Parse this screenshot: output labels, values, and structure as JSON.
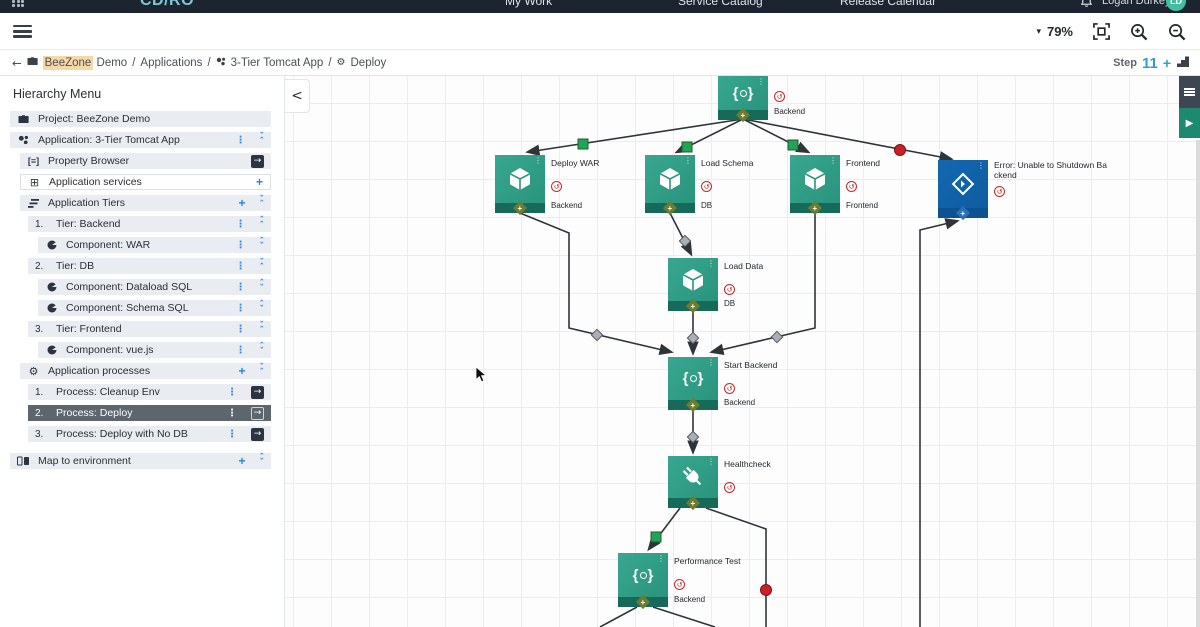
{
  "palette": {
    "teal": "#2a947d",
    "blue": "#0f5ca0",
    "red": "#c62828",
    "green_marker": "#21a453",
    "accent_blue": "#2e7fe0"
  },
  "icons": {
    "caret": "▾",
    "back": "←",
    "menu": "⋮",
    "plus": "+",
    "arrow": "→",
    "play": "▶",
    "collapse_left": "<",
    "services": "⊞",
    "gear": "⚙",
    "brackets": "[≡]",
    "chev_up": "ˆ",
    "chev_down": "ˇ",
    "badge": "↺",
    "dots": "⋮"
  },
  "topnav": {
    "logo": "CD/RO",
    "items": [
      {
        "label": "My Work"
      },
      {
        "label": "Service Catalog"
      },
      {
        "label": "Release Calendar"
      }
    ],
    "user": "Logan Durkey",
    "avatar_initials": "LD"
  },
  "toolbar": {
    "zoom_value": "79%"
  },
  "breadcrumb": {
    "project": "BeeZone",
    "project_suffix": "Demo",
    "separator": "/",
    "segments": [
      "Applications",
      "3-Tier Tomcat App",
      "Deploy"
    ],
    "step_label": "Step",
    "step_value": "11",
    "step_plus": "+"
  },
  "sidebar": {
    "title": "Hierarchy Menu",
    "items": [
      {
        "icon": "briefcase",
        "label": "Project: BeeZone Demo",
        "indent": 0,
        "actions": []
      },
      {
        "icon": "app",
        "label": "Application: 3-Tier Tomcat App",
        "indent": 0,
        "actions": [
          "menu",
          "collapse"
        ]
      },
      {
        "icon": "brackets",
        "label": "Property Browser",
        "indent": 1,
        "actions": [
          "arrow"
        ]
      },
      {
        "icon": "services",
        "label": "Application services",
        "indent": 1,
        "light": true,
        "actions": [
          "plus"
        ]
      },
      {
        "icon": "tiers",
        "label": "Application Tiers",
        "indent": 1,
        "actions": [
          "plus",
          "collapse"
        ]
      },
      {
        "num": "1.",
        "label": "Tier: Backend",
        "indent": 2,
        "actions": [
          "menu",
          "collapse"
        ]
      },
      {
        "icon": "component",
        "label": "Component: WAR",
        "indent": 3,
        "actions": [
          "menu",
          "expand"
        ]
      },
      {
        "num": "2.",
        "label": "Tier: DB",
        "indent": 2,
        "actions": [
          "menu",
          "collapse"
        ]
      },
      {
        "icon": "component",
        "label": "Component: Dataload SQL",
        "indent": 3,
        "actions": [
          "menu",
          "expand"
        ]
      },
      {
        "icon": "component",
        "label": "Component: Schema SQL",
        "indent": 3,
        "actions": [
          "menu",
          "expand"
        ]
      },
      {
        "num": "3.",
        "label": "Tier: Frontend",
        "indent": 2,
        "actions": [
          "menu",
          "collapse"
        ]
      },
      {
        "icon": "component",
        "label": "Component: vue.js",
        "indent": 3,
        "actions": [
          "menu",
          "expand"
        ]
      },
      {
        "icon": "gear",
        "label": "Application processes",
        "indent": 1,
        "actions": [
          "plus",
          "collapse"
        ]
      },
      {
        "num": "1.",
        "label": "Process: Cleanup Env",
        "indent": 2,
        "actions": [
          "menu",
          "arrow"
        ]
      },
      {
        "num": "2.",
        "label": "Process: Deploy",
        "indent": 2,
        "selected": true,
        "actions": [
          "menu",
          "arrow-outline"
        ]
      },
      {
        "num": "3.",
        "label": "Process: Deploy with No DB",
        "indent": 2,
        "actions": [
          "menu",
          "arrow"
        ]
      },
      {
        "icon": "map",
        "label": "Map to environment",
        "indent": 0,
        "gap": true,
        "actions": [
          "plus",
          "expand"
        ]
      }
    ]
  },
  "canvas": {
    "nodes": [
      {
        "id": "shutdown",
        "type": "process",
        "title": "",
        "tier": "Backend",
        "color": "teal"
      },
      {
        "id": "deploy-war",
        "type": "component",
        "title": "Deploy WAR",
        "tier": "Backend",
        "color": "teal"
      },
      {
        "id": "load-schema",
        "type": "component",
        "title": "Load Schema",
        "tier": "DB",
        "color": "teal"
      },
      {
        "id": "frontend",
        "type": "component",
        "title": "Frontend",
        "tier": "Frontend",
        "color": "teal"
      },
      {
        "id": "error-manual",
        "type": "manual",
        "title": "Error: Unable to Shutdown Backend",
        "tier": "",
        "color": "blue"
      },
      {
        "id": "load-data",
        "type": "component",
        "title": "Load Data",
        "tier": "DB",
        "color": "teal"
      },
      {
        "id": "start-backend",
        "type": "process",
        "title": "Start Backend",
        "tier": "Backend",
        "color": "teal"
      },
      {
        "id": "healthcheck",
        "type": "plug",
        "title": "Healthcheck",
        "tier": "",
        "color": "teal"
      },
      {
        "id": "performance-test",
        "type": "process",
        "title": "Performance Test",
        "tier": "Backend",
        "color": "teal"
      }
    ]
  }
}
